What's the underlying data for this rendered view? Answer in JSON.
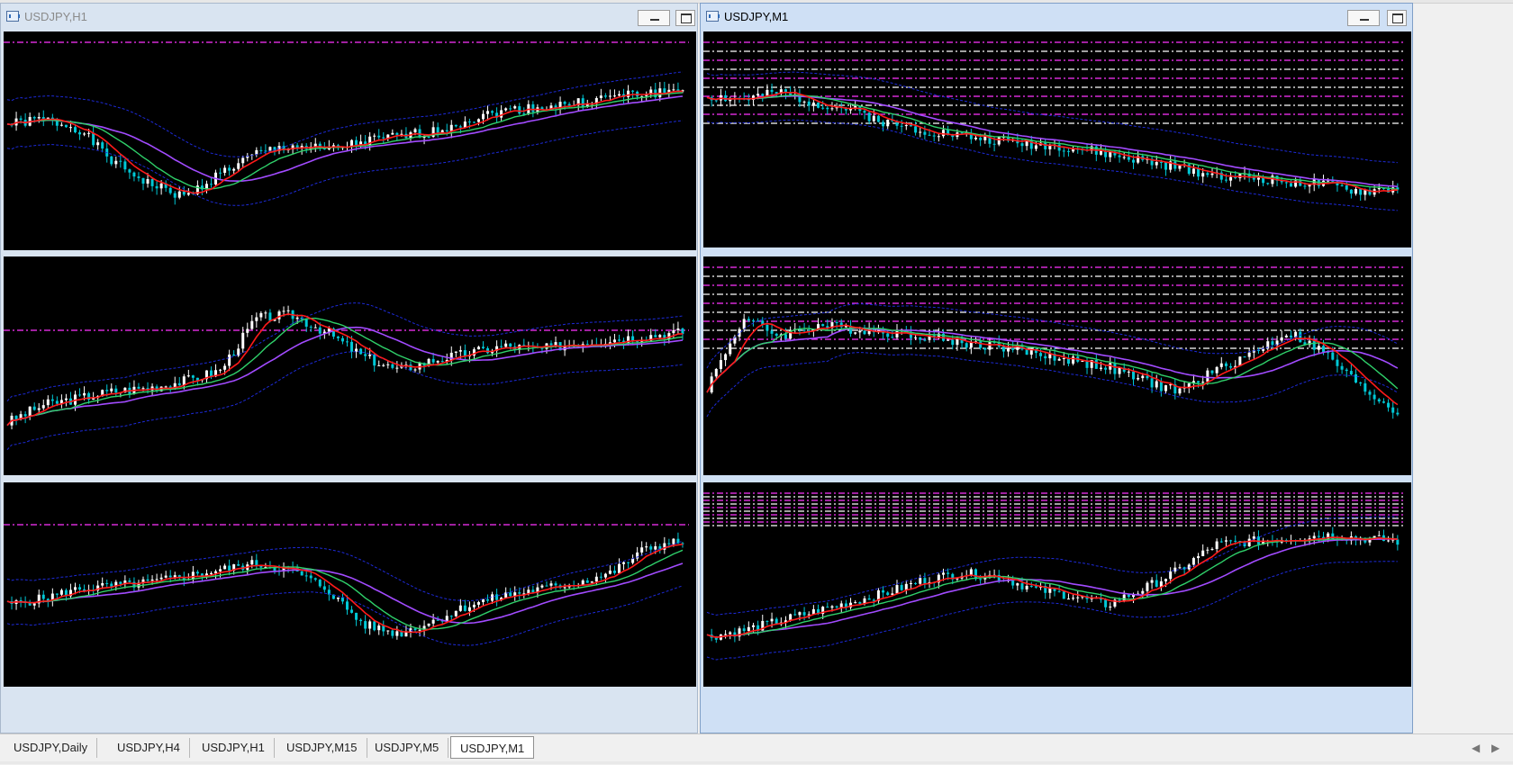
{
  "windows": [
    {
      "title": "USDJPY,H1",
      "active": false
    },
    {
      "title": "USDJPY,M1",
      "active": true
    }
  ],
  "tabs": [
    {
      "label": "USDJPY,Daily",
      "active": false
    },
    {
      "label": "USDJPY,H4",
      "active": false
    },
    {
      "label": "USDJPY,H1",
      "active": false
    },
    {
      "label": "USDJPY,M15",
      "active": false
    },
    {
      "label": "USDJPY,M5",
      "active": false
    },
    {
      "label": "USDJPY,M1",
      "active": true
    }
  ],
  "icons": {
    "window_icon": "chart-window-icon",
    "minimize": "minimize-icon",
    "maximize": "maximize-icon",
    "scroll_left": "arrow-left-icon",
    "scroll_right": "arrow-right-icon"
  },
  "colors": {
    "chart_background": "#000000",
    "bull_candle": "#ffffff",
    "bear_candle": "#00c8d6",
    "ma_fast": "#ff1a1a",
    "ma_mid": "#2fd06a",
    "ma_slow": "#a24bff",
    "band": "#1d2ad8",
    "level_magenta": "#ff33ff",
    "level_white": "#ffffff"
  },
  "chart_data": [
    {
      "type": "line",
      "series": [
        {
          "values": [
            62,
            65,
            60,
            40,
            28,
            20,
            34,
            45,
            50,
            47,
            52,
            55,
            58,
            65,
            70,
            72,
            74,
            78,
            80,
            82
          ]
        }
      ]
    },
    {
      "type": "line",
      "series": [
        {
          "values": [
            78,
            76,
            80,
            74,
            70,
            62,
            58,
            55,
            52,
            50,
            48,
            44,
            40,
            36,
            32,
            30,
            28,
            26,
            22,
            24
          ]
        }
      ]
    },
    {
      "type": "line",
      "series": [
        {
          "values": [
            20,
            30,
            34,
            38,
            40,
            44,
            50,
            80,
            82,
            72,
            58,
            50,
            56,
            60,
            64,
            62,
            66,
            68,
            70,
            72
          ]
        }
      ]
    },
    {
      "type": "line",
      "series": [
        {
          "values": [
            40,
            80,
            70,
            76,
            74,
            72,
            70,
            66,
            64,
            60,
            56,
            52,
            44,
            38,
            50,
            60,
            72,
            60,
            40,
            26
          ]
        }
      ]
    },
    {
      "type": "line",
      "series": [
        {
          "values": [
            40,
            44,
            50,
            52,
            54,
            58,
            62,
            66,
            62,
            50,
            28,
            22,
            30,
            40,
            46,
            50,
            54,
            60,
            76,
            80
          ]
        }
      ]
    },
    {
      "type": "line",
      "series": [
        {
          "values": [
            20,
            24,
            30,
            36,
            42,
            48,
            56,
            60,
            58,
            50,
            46,
            40,
            50,
            62,
            78,
            80,
            82,
            84,
            82,
            80
          ]
        }
      ]
    }
  ]
}
